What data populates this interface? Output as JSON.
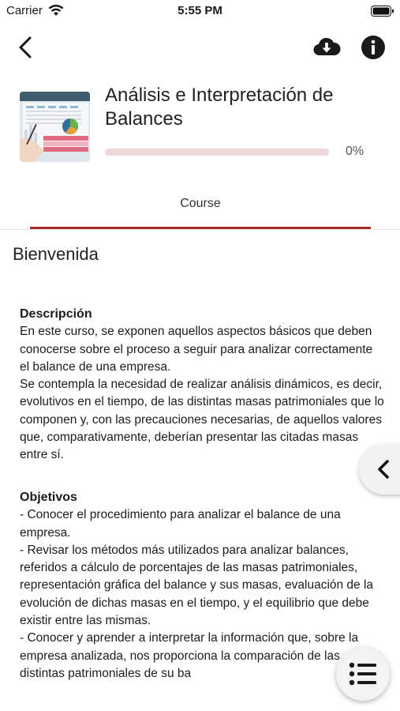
{
  "status_bar": {
    "carrier": "Carrier",
    "time": "5:55 PM",
    "wifi_icon": "wifi-icon",
    "battery_icon": "battery-icon"
  },
  "nav_bar": {
    "back_icon": "chevron-left-icon",
    "download_icon": "cloud-download-icon",
    "info_icon": "info-icon"
  },
  "course": {
    "title": "Análisis e Interpretación de Balances",
    "progress": 0,
    "progress_label": "0%",
    "accent_color": "#a52a2a",
    "progress_track_color": "#ecd9d9"
  },
  "tabs": [
    {
      "label": "Course",
      "active": true
    }
  ],
  "content": {
    "title": "Bienvenida",
    "sections": [
      {
        "heading": "Descripción",
        "paragraphs": [
          "En este curso, se exponen aquellos aspectos básicos que deben conocerse sobre el proceso a seguir para analizar correctamente el balance de una empresa.",
          "Se contempla la necesidad de realizar análisis dinámicos, es decir, evolutivos en el tiempo, de las distintas masas patrimoniales que lo componen y, con las precauciones necesarias, de aquellos valores que, comparativamente, deberían presentar las citadas masas entre sí."
        ]
      },
      {
        "heading": "Objetivos",
        "paragraphs": [
          "- Conocer el procedimiento para analizar el balance de una empresa.",
          "- Revisar los métodos más utilizados para analizar balances, referidos a cálculo de porcentajes de las masas patrimoniales, representación gráfica del balance y sus masas, evaluación de la evolución de dichas masas en el tiempo, y el equilibrio que debe existir entre las mismas.",
          "- Conocer y aprender a interpretar la información que, sobre la empresa analizada, nos proporciona la comparación de las distintas patrimoniales de su ba"
        ]
      }
    ]
  },
  "floating": {
    "side_tab_icon": "chevron-left-icon",
    "menu_icon": "list-menu-icon"
  }
}
